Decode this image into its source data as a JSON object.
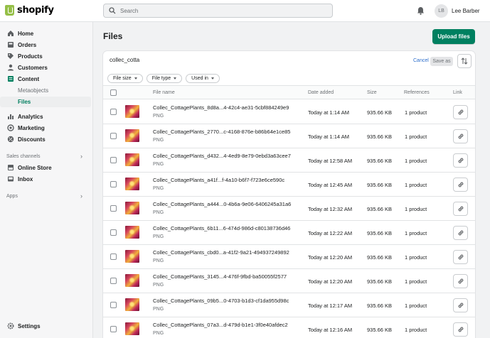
{
  "brand": {
    "name": "shopify"
  },
  "topbar": {
    "search_placeholder": "Search",
    "avatar_initials": "LB",
    "user_name": "Lee Barber"
  },
  "sidebar": {
    "items": [
      {
        "label": "Home",
        "icon": "home-icon"
      },
      {
        "label": "Orders",
        "icon": "orders-icon"
      },
      {
        "label": "Products",
        "icon": "tag-icon"
      },
      {
        "label": "Customers",
        "icon": "person-icon"
      },
      {
        "label": "Content",
        "icon": "content-icon"
      },
      {
        "label": "Metaobjects"
      },
      {
        "label": "Files"
      },
      {
        "label": "Analytics",
        "icon": "analytics-icon"
      },
      {
        "label": "Marketing",
        "icon": "marketing-icon"
      },
      {
        "label": "Discounts",
        "icon": "discount-icon"
      }
    ],
    "sales_channels_label": "Sales channels",
    "channels": [
      {
        "label": "Online Store",
        "icon": "store-icon"
      },
      {
        "label": "Inbox",
        "icon": "inbox-icon"
      }
    ],
    "apps_label": "Apps",
    "settings_label": "Settings"
  },
  "page": {
    "title": "Files",
    "upload_label": "Upload files"
  },
  "filters": {
    "query": "collec_cotta",
    "cancel_label": "Cancel",
    "save_as_label": "Save as",
    "chips": [
      "File size",
      "File type",
      "Used in"
    ]
  },
  "table": {
    "headers": {
      "file_name": "File name",
      "date_added": "Date added",
      "size": "Size",
      "references": "References",
      "link": "Link"
    },
    "rows": [
      {
        "name": "Collec_CottagePlants_8d8a...4-42c4-ae31-5cbf884249e9",
        "type": "PNG",
        "date": "Today at 1:14 AM",
        "size": "935.66 KB",
        "refs": "1 product"
      },
      {
        "name": "Collec_CottagePlants_2770...c-4168-876e-b86b64e1ce85",
        "type": "PNG",
        "date": "Today at 1:14 AM",
        "size": "935.66 KB",
        "refs": "1 product"
      },
      {
        "name": "Collec_CottagePlants_d432...4-4ed9-8e79-0ebd3a63cee7",
        "type": "PNG",
        "date": "Today at 12:58 AM",
        "size": "935.66 KB",
        "refs": "1 product"
      },
      {
        "name": "Collec_CottagePlants_a41f...f-4a10-b6f7-f723e6ce590c",
        "type": "PNG",
        "date": "Today at 12:45 AM",
        "size": "935.66 KB",
        "refs": "1 product"
      },
      {
        "name": "Collec_CottagePlants_a444...0-4b6a-9e06-6406245a31a6",
        "type": "PNG",
        "date": "Today at 12:32 AM",
        "size": "935.66 KB",
        "refs": "1 product"
      },
      {
        "name": "Collec_CottagePlants_6b11...6-474d-986d-c80138736d46",
        "type": "PNG",
        "date": "Today at 12:22 AM",
        "size": "935.66 KB",
        "refs": "1 product"
      },
      {
        "name": "Collec_CottagePlants_cbd0...a-41f2-9a21-494937249892",
        "type": "PNG",
        "date": "Today at 12:20 AM",
        "size": "935.66 KB",
        "refs": "1 product"
      },
      {
        "name": "Collec_CottagePlants_3145...4-476f-9fbd-ba50055f2577",
        "type": "PNG",
        "date": "Today at 12:20 AM",
        "size": "935.66 KB",
        "refs": "1 product"
      },
      {
        "name": "Collec_CottagePlants_09b5...0-4703-b1d3-cf1da955d98c",
        "type": "PNG",
        "date": "Today at 12:17 AM",
        "size": "935.66 KB",
        "refs": "1 product"
      },
      {
        "name": "Collec_CottagePlants_07a3...d-479d-b1e1-3f0e40afdec2",
        "type": "PNG",
        "date": "Today at 12:16 AM",
        "size": "935.66 KB",
        "refs": "1 product"
      }
    ]
  },
  "colors": {
    "accent": "#008060",
    "active_nav": "#007f5f",
    "link": "#2c6ecb"
  }
}
